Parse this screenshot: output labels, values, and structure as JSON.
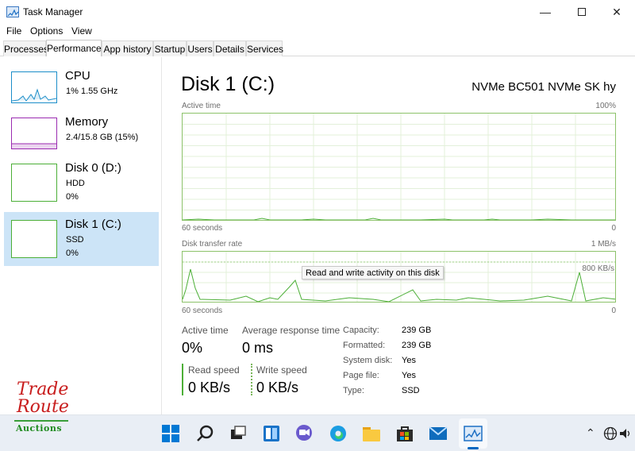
{
  "window": {
    "title": "Task Manager"
  },
  "menu": [
    "File",
    "Options",
    "View"
  ],
  "tabs": [
    "Processes",
    "Performance",
    "App history",
    "Startup",
    "Users",
    "Details",
    "Services"
  ],
  "active_tab": "Performance",
  "sidebar": {
    "items": [
      {
        "title": "CPU",
        "sub1": "1%  1.55 GHz",
        "sub2": "",
        "color": "#1c8ec9"
      },
      {
        "title": "Memory",
        "sub1": "2.4/15.8 GB (15%)",
        "sub2": "",
        "color": "#9b2cb1"
      },
      {
        "title": "Disk 0 (D:)",
        "sub1": "HDD",
        "sub2": "0%",
        "color": "#4caf37"
      },
      {
        "title": "Disk 1 (C:)",
        "sub1": "SSD",
        "sub2": "0%",
        "color": "#4caf37"
      }
    ],
    "selected": 3
  },
  "main": {
    "title": "Disk 1 (C:)",
    "model": "NVMe BC501 NVMe SK hy",
    "active_graph": {
      "label": "Active time",
      "max_label": "100%",
      "time_label": "60 seconds",
      "min_label": "0"
    },
    "transfer_graph": {
      "label": "Disk transfer rate",
      "max_label": "1 MB/s",
      "mid_label": "800 KB/s",
      "time_label": "60 seconds",
      "min_label": "0"
    },
    "tooltip": "Read and write activity on this disk",
    "stats": {
      "active_time_label": "Active time",
      "active_time_value": "0%",
      "avg_response_label": "Average response time",
      "avg_response_value": "0 ms",
      "read_speed_label": "Read speed",
      "read_speed_value": "0 KB/s",
      "write_speed_label": "Write speed",
      "write_speed_value": "0 KB/s"
    },
    "properties": [
      {
        "label": "Capacity:",
        "value": "239 GB"
      },
      {
        "label": "Formatted:",
        "value": "239 GB"
      },
      {
        "label": "System disk:",
        "value": "Yes"
      },
      {
        "label": "Page file:",
        "value": "Yes"
      },
      {
        "label": "Type:",
        "value": "SSD"
      }
    ]
  },
  "logo": {
    "line1": "Trade",
    "line2": "Route",
    "line3": "Auctions"
  },
  "colors": {
    "accent": "#0067c0",
    "disk_green": "#4caf37",
    "selected_bg": "#cce4f7"
  },
  "taskbar_icons": [
    "windows-start-icon",
    "search-icon",
    "task-view-icon",
    "widgets-icon",
    "chat-icon",
    "edge-icon",
    "file-explorer-icon",
    "store-icon",
    "mail-icon",
    "task-manager-icon"
  ]
}
